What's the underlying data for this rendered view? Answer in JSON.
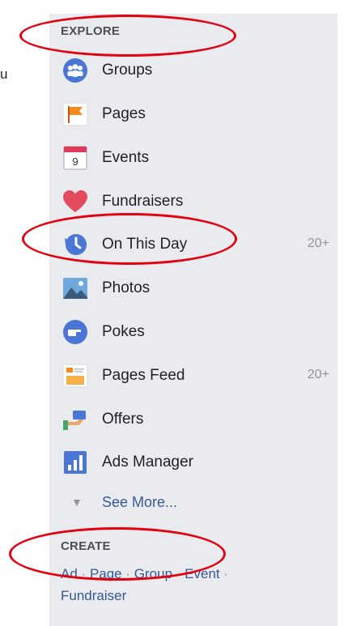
{
  "cut_text": "u",
  "explore": {
    "title": "EXPLORE",
    "items": [
      {
        "label": "Groups",
        "icon": "groups-icon"
      },
      {
        "label": "Pages",
        "icon": "pages-flag-icon"
      },
      {
        "label": "Events",
        "icon": "calendar-icon"
      },
      {
        "label": "Fundraisers",
        "icon": "heart-icon"
      },
      {
        "label": "On This Day",
        "icon": "history-clock-icon",
        "count": "20+"
      },
      {
        "label": "Photos",
        "icon": "photos-icon"
      },
      {
        "label": "Pokes",
        "icon": "pokes-icon"
      },
      {
        "label": "Pages Feed",
        "icon": "pages-feed-icon",
        "count": "20+"
      },
      {
        "label": "Offers",
        "icon": "offers-icon"
      },
      {
        "label": "Ads Manager",
        "icon": "ads-manager-icon"
      }
    ],
    "see_more": "See More...",
    "calendar_day": "9"
  },
  "create": {
    "title": "CREATE",
    "links": [
      "Ad",
      "Page",
      "Group",
      "Event",
      "Fundraiser"
    ],
    "separator": "·"
  },
  "colors": {
    "panel_bg": "#e9ebee",
    "link": "#365899",
    "annotation": "#e3000f"
  }
}
